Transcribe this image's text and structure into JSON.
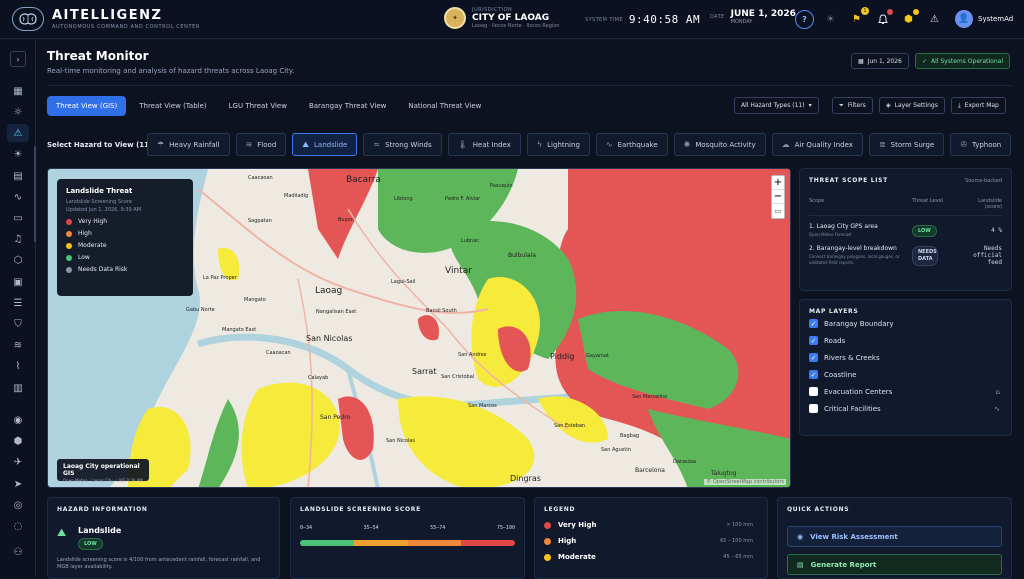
{
  "brand": {
    "name": "AITELLIGENZ",
    "subtitle": "AUTONOMOUS COMMAND AND CONTROL CENTER"
  },
  "jurisdiction": {
    "label": "JURISDICTION",
    "city": "CITY OF LAOAG",
    "region": "Laoag · Ilocos Norte · Ilocos Region"
  },
  "system_time": {
    "label": "SYSTEM TIME",
    "value": "9:40:58 AM"
  },
  "date": {
    "label": "DATE",
    "value": "JUNE 1, 2026",
    "day": "MONDAY"
  },
  "top_icons": [
    {
      "name": "help-icon",
      "glyph": "?"
    },
    {
      "name": "theme-icon",
      "glyph": "☀"
    },
    {
      "name": "alert-badge-icon",
      "glyph": "⚑",
      "badge": "1"
    },
    {
      "name": "notification-icon",
      "glyph": "🔔"
    },
    {
      "name": "package-icon",
      "glyph": "⬢"
    },
    {
      "name": "warning-icon",
      "glyph": "⚠"
    }
  ],
  "user": {
    "name": "SystemAd"
  },
  "page": {
    "title": "Threat Monitor",
    "subtitle": "Real-time monitoring and analysis of hazard threats across Laoag City."
  },
  "header_actions": {
    "date": "Jun 1, 2026",
    "status": "All Systems Operational"
  },
  "tabs": [
    {
      "label": "Threat View (GIS)",
      "active": true
    },
    {
      "label": "Threat View (Table)"
    },
    {
      "label": "LGU Threat View"
    },
    {
      "label": "Barangay Threat View"
    },
    {
      "label": "National Threat View"
    }
  ],
  "toolbar": {
    "hazard_types": "All Hazard Types (11)",
    "filters": "Filters",
    "layer_settings": "Layer Settings",
    "export": "Export Map"
  },
  "hazard_select": {
    "label": "Select Hazard to View (11)",
    "items": [
      {
        "label": "Heavy Rainfall",
        "icon": "☂"
      },
      {
        "label": "Flood",
        "icon": "≋"
      },
      {
        "label": "Landslide",
        "icon": "⛰",
        "active": true
      },
      {
        "label": "Strong Winds",
        "icon": "≈"
      },
      {
        "label": "Heat Index",
        "icon": "🌡"
      },
      {
        "label": "Lightning",
        "icon": "ϟ"
      },
      {
        "label": "Earthquake",
        "icon": "∿"
      },
      {
        "label": "Mosquito Activity",
        "icon": "✺"
      },
      {
        "label": "Air Quality Index",
        "icon": "☁"
      },
      {
        "label": "Storm Surge",
        "icon": "≣"
      },
      {
        "label": "Typhoon",
        "icon": "✇"
      }
    ]
  },
  "map": {
    "legend_title": "Landslide Threat",
    "legend_sub": "Landslide Screening Score",
    "legend_updated": "Updated Jun 1, 2026, 9:39 AM",
    "legend_items": [
      {
        "label": "Very High",
        "color": "#e04848"
      },
      {
        "label": "High",
        "color": "#f0883a"
      },
      {
        "label": "Moderate",
        "color": "#f5c518"
      },
      {
        "label": "Low",
        "color": "#4cc27a"
      },
      {
        "label": "Needs Data Risk",
        "color": "#8a93a6"
      }
    ],
    "badge_title": "Laoag City operational GIS",
    "badge_sub": "Open-Meteo · Laoag City · LIVE 9:39 AM",
    "attribution": "© OpenStreetMap contributors",
    "places": [
      "Bacarra",
      "Caacaoan",
      "Madiladig",
      "Libtong",
      "Pasuquin",
      "Pedro F. Alviar",
      "Buyon",
      "Laoag",
      "Lagui-Sail",
      "Vintar",
      "Bulbulala",
      "Gabu Norte",
      "Mangato East",
      "Nangalisan East",
      "Bacsil South",
      "La Paz Proper",
      "San Nicolas",
      "Sarrat",
      "San Andres",
      "Piddig",
      "Gayamat",
      "San Cristobal",
      "San Pedro",
      "Dingras",
      "San Marcos",
      "Bagbag",
      "San Nicolas",
      "San Agustin",
      "Barcelona",
      "Talugtog",
      "San Marcelino",
      "Darasdas",
      "San Esteban",
      "Lubnac",
      "Sagpatan",
      "Mangato",
      "Calayab",
      "Caaoacan"
    ]
  },
  "scope": {
    "title": "THREAT SCOPE LIST",
    "tag": "Source-backed",
    "headers": [
      "Scope",
      "Threat Level",
      "Landslide (score)"
    ],
    "rows": [
      {
        "num": "1.",
        "name": "Laoag City GPS area",
        "sub": "Open-Meteo Forecast",
        "level": "LOW",
        "value": "4 %"
      },
      {
        "num": "2.",
        "name": "Barangay-level breakdown",
        "sub": "Connect barangay polygons, local gauges, or validated field reports.",
        "level": "NEEDS DATA",
        "value": "Needs official feed"
      }
    ]
  },
  "layers": {
    "title": "MAP LAYERS",
    "items": [
      {
        "label": "Barangay Boundary",
        "on": true
      },
      {
        "label": "Roads",
        "on": true
      },
      {
        "label": "Rivers & Creeks",
        "on": true
      },
      {
        "label": "Coastline",
        "on": true
      },
      {
        "label": "Evacuation Centers",
        "on": false,
        "icon": "⌂"
      },
      {
        "label": "Critical Facilities",
        "on": false,
        "icon": "∿"
      }
    ]
  },
  "hazard_info": {
    "title": "HAZARD INFORMATION",
    "name": "Landslide",
    "level": "LOW",
    "text": "Landslide screening score is 4/100 from antecedent rainfall, forecast rainfall, and MGB layer availability."
  },
  "score": {
    "title": "LANDSLIDE SCREENING SCORE",
    "ticks": [
      "0–34",
      "35–54",
      "55–74",
      "75–100"
    ],
    "colors": [
      "#4cc27a",
      "#f0a030",
      "#f0883a",
      "#e04848"
    ]
  },
  "legend_panel": {
    "title": "LEGEND",
    "items": [
      {
        "label": "Very High",
        "range": "> 100 mm",
        "color": "#e04848"
      },
      {
        "label": "High",
        "range": "65 – 100 mm",
        "color": "#f0883a"
      },
      {
        "label": "Moderate",
        "range": "45 – 65 mm",
        "color": "#f5c518"
      }
    ]
  },
  "quick_actions": {
    "title": "QUICK ACTIONS",
    "view_risk": "View Risk Assessment",
    "generate_report": "Generate Report"
  }
}
